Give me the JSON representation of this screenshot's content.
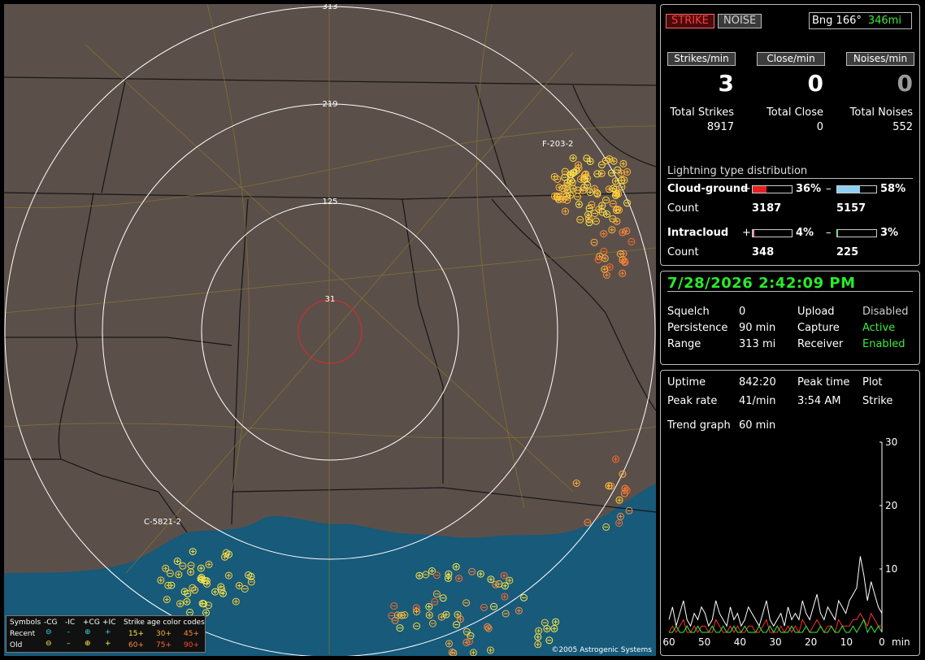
{
  "map": {
    "range_labels": [
      "313",
      "219",
      "125",
      "31"
    ],
    "storm_labels": [
      "F-203-2",
      "C-5821-2"
    ],
    "copyright": "©2005 Astrogenic Systems",
    "legend": {
      "symbols_label": "Symbols",
      "headers": [
        "-CG",
        "-IC",
        "+CG",
        "+IC"
      ],
      "age_title": "Strike age color codes",
      "recent_label": "Recent",
      "old_label": "Old",
      "recent_ages": [
        "15+",
        "30+",
        "45+"
      ],
      "old_ages": [
        "60+",
        "75+",
        "90+"
      ]
    }
  },
  "status": {
    "strike_button": "STRIKE",
    "noise_button": "NOISE",
    "bearing": "Bng 166°",
    "distance": "346mi",
    "rates": {
      "strikes_label": "Strikes/min",
      "strikes_value": "3",
      "close_label": "Close/min",
      "close_value": "0",
      "noises_label": "Noises/min",
      "noises_value": "0"
    },
    "totals": {
      "strikes_label": "Total Strikes",
      "strikes_value": "8917",
      "close_label": "Total Close",
      "close_value": "0",
      "noises_label": "Total Noises",
      "noises_value": "552"
    },
    "distribution": {
      "title": "Lightning type distribution",
      "cg_label": "Cloud-ground",
      "cg_pos_sign": "+",
      "cg_pos_pct": "36%",
      "cg_pos_frac": 0.36,
      "cg_neg_sign": "–",
      "cg_neg_pct": "58%",
      "cg_neg_frac": 0.58,
      "count_label": "Count",
      "cg_pos_count": "3187",
      "cg_neg_count": "5157",
      "ic_label": "Intracloud",
      "ic_pos_sign": "+",
      "ic_pos_pct": "4%",
      "ic_pos_frac": 0.04,
      "ic_neg_sign": "–",
      "ic_neg_pct": "3%",
      "ic_neg_frac": 0.03,
      "ic_pos_count": "348",
      "ic_neg_count": "225"
    }
  },
  "settings": {
    "datetime": "7/28/2026 2:42:09 PM",
    "squelch_label": "Squelch",
    "squelch_value": "0",
    "persistence_label": "Persistence",
    "persistence_value": "90 min",
    "range_label": "Range",
    "range_value": "313 mi",
    "upload_label": "Upload",
    "upload_value": "Disabled",
    "capture_label": "Capture",
    "capture_value": "Active",
    "receiver_label": "Receiver",
    "receiver_value": "Enabled"
  },
  "stats": {
    "uptime_label": "Uptime",
    "uptime_value": "842:20",
    "peak_time_label": "Peak time",
    "peak_time_value": "3:54 AM",
    "plot_label": "Plot",
    "plot_value": "Strike",
    "peak_rate_label": "Peak rate",
    "peak_rate_value": "41/min",
    "trend_label": "Trend graph",
    "trend_value": "60 min"
  },
  "chart_data": {
    "type": "line",
    "title": "",
    "x_ticks": [
      "60",
      "50",
      "40",
      "30",
      "20",
      "10",
      "0"
    ],
    "x_unit": "min",
    "y_ticks": [
      "30",
      "20",
      "10"
    ],
    "ylim": [
      0,
      30
    ],
    "xlim": [
      60,
      0
    ],
    "series": [
      {
        "color": "#ffffff",
        "values": [
          2,
          4,
          1,
          3,
          5,
          2,
          1,
          3,
          2,
          4,
          3,
          1,
          2,
          5,
          3,
          2,
          1,
          4,
          2,
          3,
          1,
          2,
          4,
          3,
          2,
          1,
          3,
          5,
          2,
          1,
          2,
          3,
          1,
          4,
          2,
          3,
          2,
          5,
          3,
          2,
          4,
          6,
          3,
          2,
          4,
          3,
          2,
          5,
          4,
          3,
          5,
          6,
          7,
          12,
          9,
          5,
          8,
          6,
          4,
          3
        ]
      },
      {
        "color": "#ff3030",
        "values": [
          0,
          1,
          0,
          1,
          2,
          0,
          0,
          1,
          0,
          1,
          1,
          0,
          0,
          2,
          1,
          0,
          0,
          1,
          0,
          1,
          0,
          0,
          1,
          1,
          0,
          0,
          1,
          2,
          0,
          0,
          0,
          1,
          0,
          1,
          0,
          1,
          0,
          2,
          1,
          0,
          1,
          2,
          1,
          0,
          1,
          1,
          0,
          2,
          1,
          1,
          1,
          2,
          2,
          3,
          2,
          1,
          3,
          2,
          1,
          1
        ]
      },
      {
        "color": "#3bea3b",
        "values": [
          0,
          0,
          1,
          0,
          0,
          1,
          0,
          0,
          1,
          0,
          0,
          0,
          1,
          0,
          0,
          1,
          0,
          0,
          1,
          0,
          0,
          1,
          0,
          0,
          0,
          1,
          0,
          0,
          1,
          0,
          1,
          0,
          0,
          0,
          1,
          0,
          0,
          0,
          1,
          0,
          0,
          0,
          1,
          0,
          0,
          1,
          0,
          0,
          1,
          0,
          0,
          1,
          0,
          1,
          2,
          0,
          1,
          0,
          1,
          0
        ]
      }
    ]
  }
}
